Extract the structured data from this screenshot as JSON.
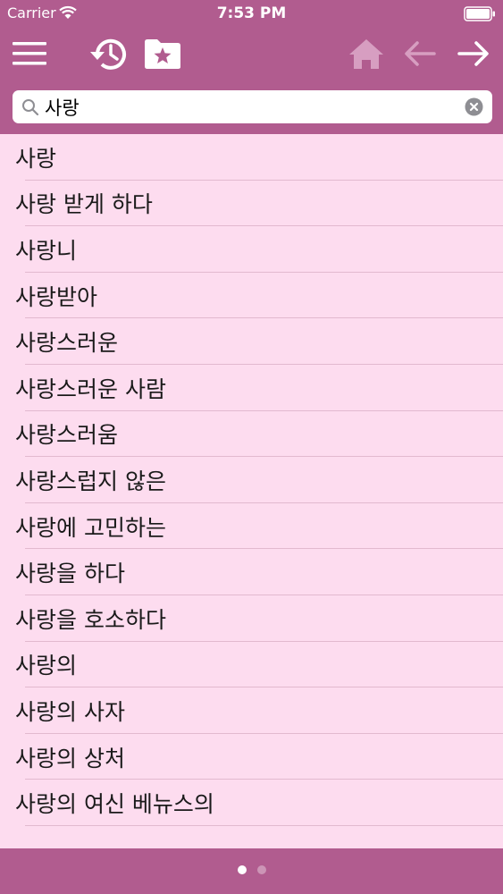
{
  "status_bar": {
    "carrier": "Carrier",
    "time": "7:53 PM",
    "wifi_icon": "wifi-icon",
    "battery_icon": "battery-icon"
  },
  "toolbar": {
    "icons": [
      "menu-icon",
      "history-icon",
      "favorites-folder-icon",
      "home-icon",
      "back-arrow-icon",
      "forward-arrow-icon"
    ]
  },
  "search": {
    "value": "사랑",
    "placeholder": ""
  },
  "results": [
    "사랑",
    "사랑 받게 하다",
    "사랑니",
    "사랑받아",
    "사랑스러운",
    "사랑스러운 사람",
    "사랑스러움",
    "사랑스럽지 않은",
    "사랑에 고민하는",
    "사랑을 하다",
    "사랑을 호소하다",
    "사랑의",
    "사랑의 사자",
    "사랑의 상처",
    "사랑의 여신 베뉴스의"
  ],
  "pagination": {
    "total": 2,
    "current": 1
  },
  "colors": {
    "header": "#b15c8f",
    "list_background": "#fddcef",
    "separator": "#e2b9cf",
    "icon_active": "#ffffff",
    "icon_disabled": "#d79ec1"
  }
}
